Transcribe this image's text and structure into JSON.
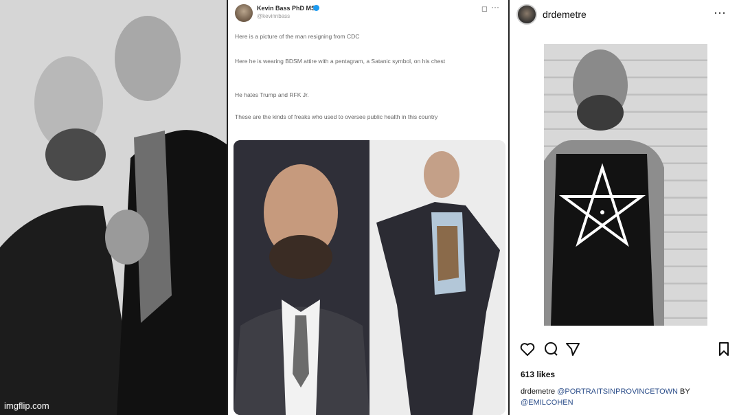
{
  "left_panel": {
    "photo_alt": "two bald bearded men, one kissing the other's cheek",
    "watermark": "imgflip.com"
  },
  "tweet": {
    "author_name": "Kevin Bass PhD MS",
    "author_handle": "@kevinnbass",
    "paragraphs": [
      "Here is a picture of the man resigning from CDC",
      "Here he is wearing BDSM attire with a pentagram, a Satanic symbol, on his chest",
      "He hates Trump and RFK Jr.",
      "These are the kinds of freaks who used to oversee public health in this country"
    ],
    "media": {
      "left_alt": "smiling bald man in suit and striped tie",
      "right_alt": "bald man in open dark suit posing"
    },
    "icons": [
      "avatar",
      "verified-badge-icon",
      "grok-icon",
      "more-icon"
    ]
  },
  "instagram": {
    "username": "drdemetre",
    "photo_alt": "bald man wearing black tank top with white pentagram harness",
    "likes": "613 likes",
    "caption_user": "drdemetre",
    "caption_mentions": [
      "@PORTRAITSINPROVINCETOWN",
      "BY",
      "@EMILCOHEN"
    ],
    "icons": [
      "heart-icon",
      "comment-icon",
      "share-icon",
      "bookmark-icon",
      "more-icon"
    ]
  }
}
